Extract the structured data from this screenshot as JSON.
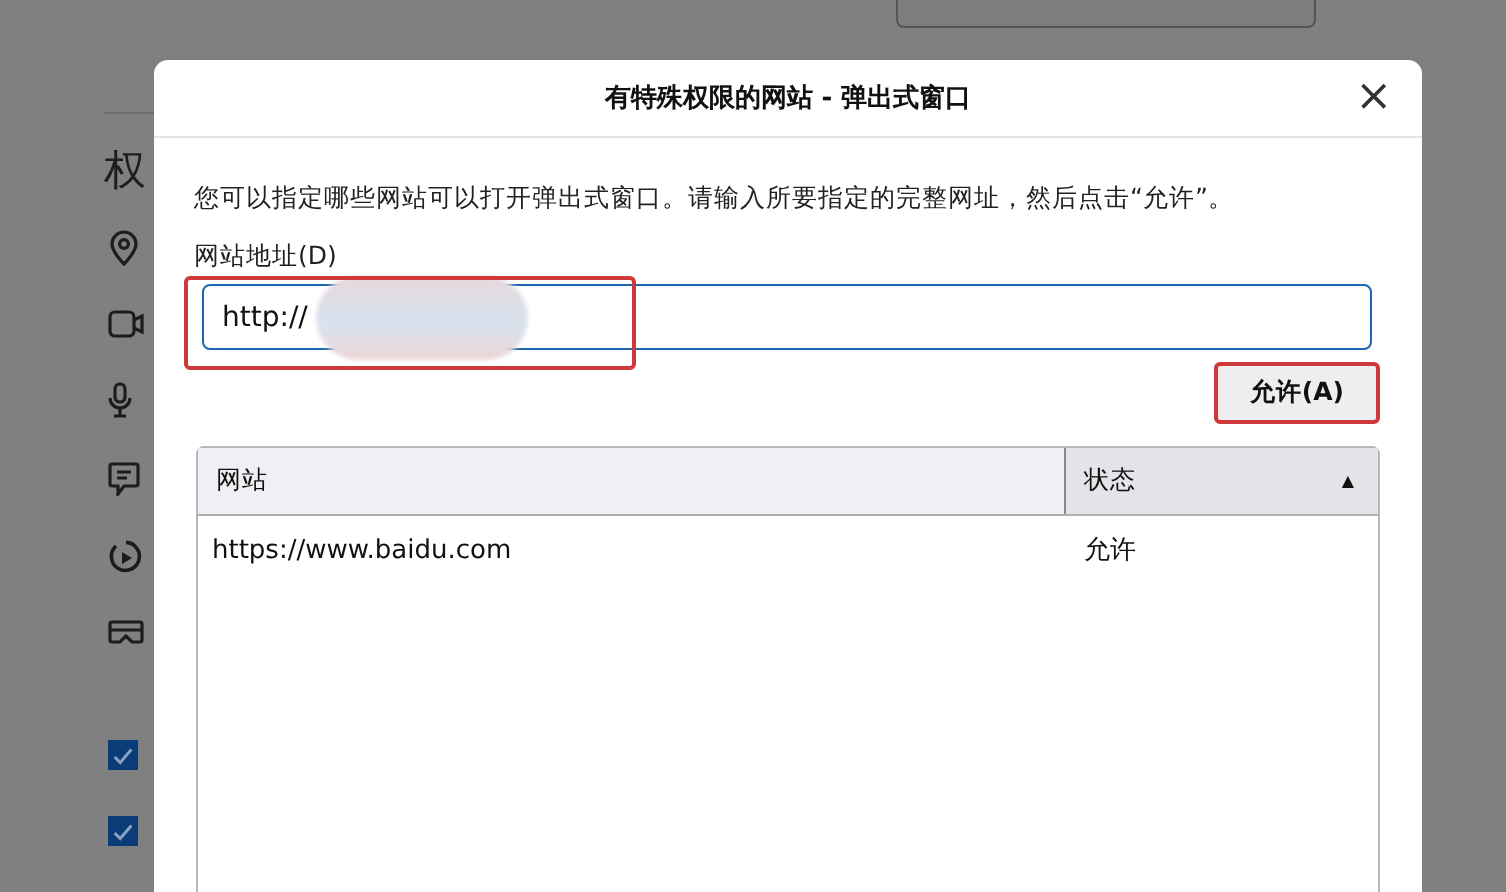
{
  "background_page": {
    "heading": "权",
    "permissions": [
      {
        "kind": "location"
      },
      {
        "kind": "camera"
      },
      {
        "kind": "microphone"
      },
      {
        "kind": "notifications"
      },
      {
        "kind": "autoplay"
      },
      {
        "kind": "vr"
      }
    ],
    "checkboxes": [
      {
        "checked": true
      },
      {
        "checked": true
      }
    ]
  },
  "dialog": {
    "title": "有特殊权限的网站 - 弹出式窗口",
    "close": "×",
    "description": "您可以指定哪些网站可以打开弹出式窗口。请输入所要指定的完整网址，然后点击“允许”。",
    "field_label": "网站地址(D)",
    "field_value": "http://",
    "allow_button": "允许(A)",
    "table": {
      "columns": [
        {
          "label": "网站",
          "sorted": false
        },
        {
          "label": "状态",
          "sorted": true,
          "sort_icon": "▲"
        }
      ],
      "rows": [
        {
          "site": "https://www.baidu.com",
          "status": "允许"
        }
      ]
    }
  }
}
